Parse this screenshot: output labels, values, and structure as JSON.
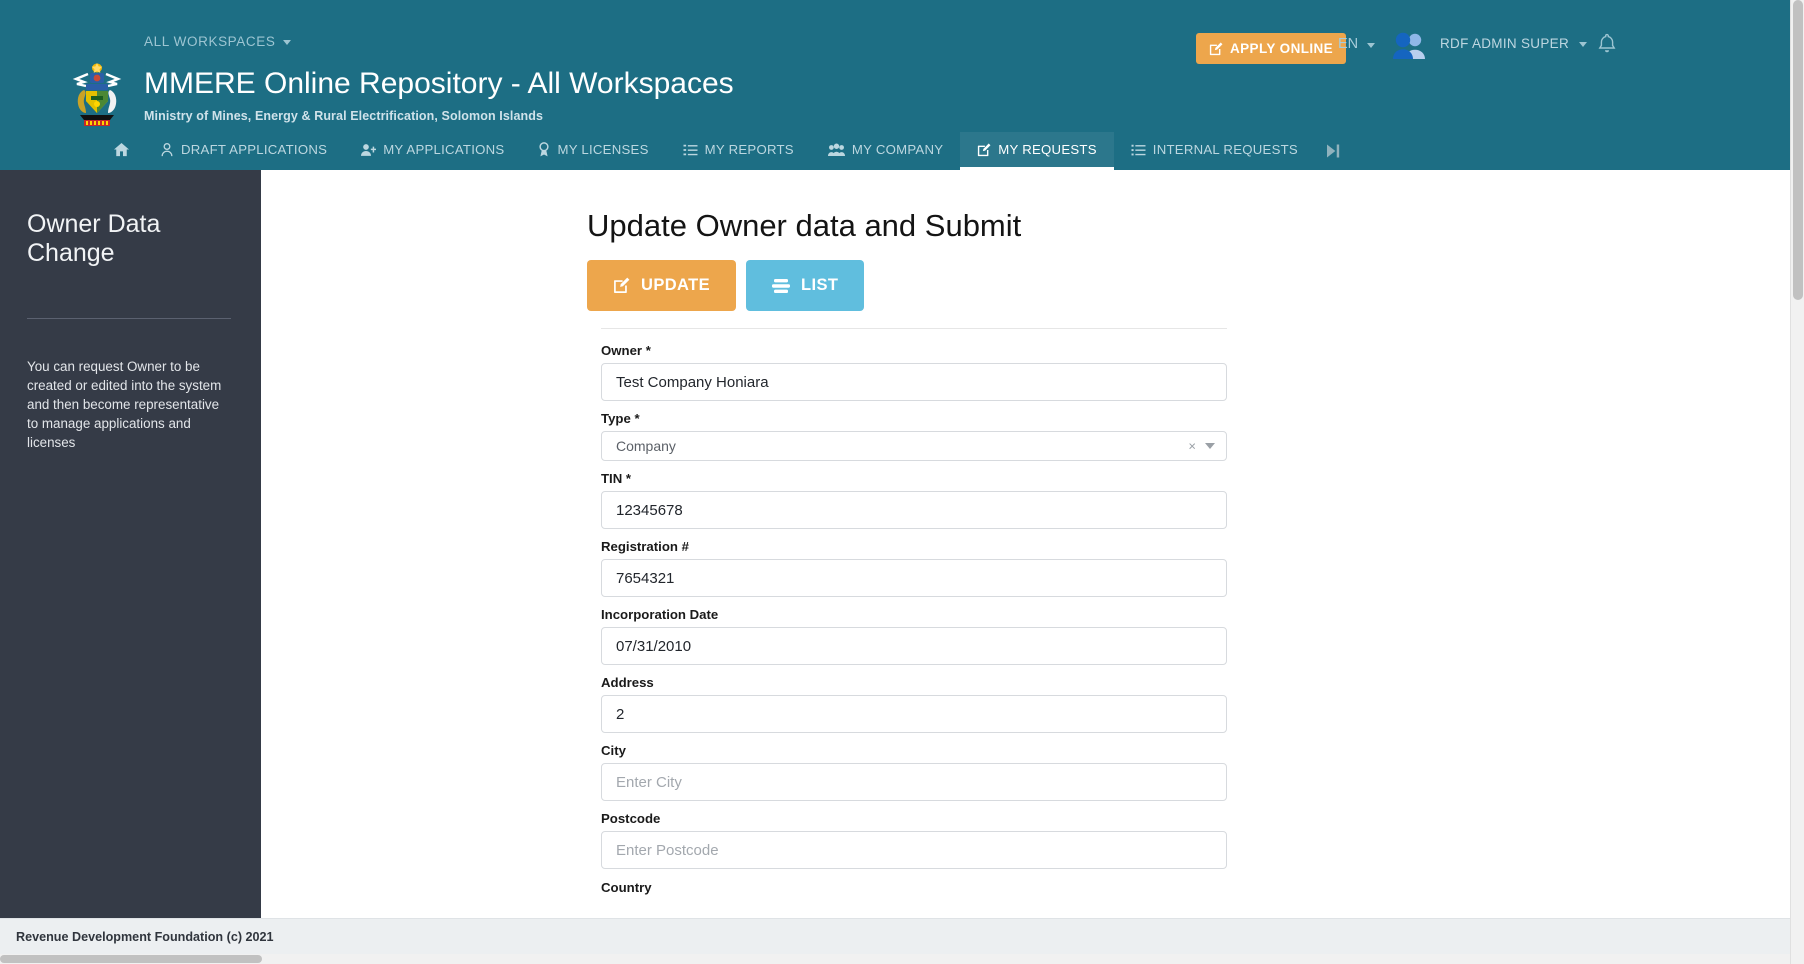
{
  "header": {
    "workspaces_label": "ALL WORKSPACES",
    "apply_online_label": "APPLY ONLINE",
    "language": "EN",
    "user_name": "RDF ADMIN SUPER",
    "title": "MMERE Online Repository - All Workspaces",
    "subtitle": "Ministry of Mines, Energy & Rural Electrification, Solomon Islands",
    "background_color": "#1d6e84",
    "accent_color": "#eda64c"
  },
  "nav": {
    "items": [
      {
        "label": "",
        "icon": "home-icon",
        "active": false
      },
      {
        "label": "DRAFT APPLICATIONS",
        "icon": "draft-applications-icon",
        "active": false
      },
      {
        "label": "MY APPLICATIONS",
        "icon": "my-applications-icon",
        "active": false
      },
      {
        "label": "MY LICENSES",
        "icon": "my-licenses-icon",
        "active": false
      },
      {
        "label": "MY REPORTS",
        "icon": "my-reports-icon",
        "active": false
      },
      {
        "label": "MY COMPANY",
        "icon": "my-company-icon",
        "active": false
      },
      {
        "label": "MY REQUESTS",
        "icon": "my-requests-icon",
        "active": true
      },
      {
        "label": "INTERNAL REQUESTS",
        "icon": "internal-requests-icon",
        "active": false
      }
    ],
    "end_icon": "skip-forward-icon"
  },
  "sidebar": {
    "title": "Owner Data Change",
    "description": "You can request Owner to be created or edited into the system and then become representative to manage applications and licenses",
    "background_color": "#353b47"
  },
  "main": {
    "page_title": "Update Owner data and Submit",
    "buttons": [
      {
        "label": "UPDATE",
        "icon": "edit-icon",
        "color": "#eda64c"
      },
      {
        "label": "LIST",
        "icon": "list-icon",
        "color": "#60bede"
      }
    ],
    "form": {
      "fields": [
        {
          "label": "Owner *",
          "type": "text",
          "value": "Test Company Honiara",
          "placeholder": ""
        },
        {
          "label": "Type *",
          "type": "select",
          "value": "Company",
          "placeholder": ""
        },
        {
          "label": "TIN *",
          "type": "text",
          "value": "12345678",
          "placeholder": ""
        },
        {
          "label": "Registration #",
          "type": "text",
          "value": "7654321",
          "placeholder": ""
        },
        {
          "label": "Incorporation Date",
          "type": "text",
          "value": "07/31/2010",
          "placeholder": ""
        },
        {
          "label": "Address",
          "type": "text",
          "value": "2",
          "placeholder": ""
        },
        {
          "label": "City",
          "type": "text",
          "value": "",
          "placeholder": "Enter City"
        },
        {
          "label": "Postcode",
          "type": "text",
          "value": "",
          "placeholder": "Enter Postcode"
        }
      ],
      "cut_off_label": "Country"
    }
  },
  "footer": {
    "text": "Revenue Development Foundation (c) 2021"
  }
}
